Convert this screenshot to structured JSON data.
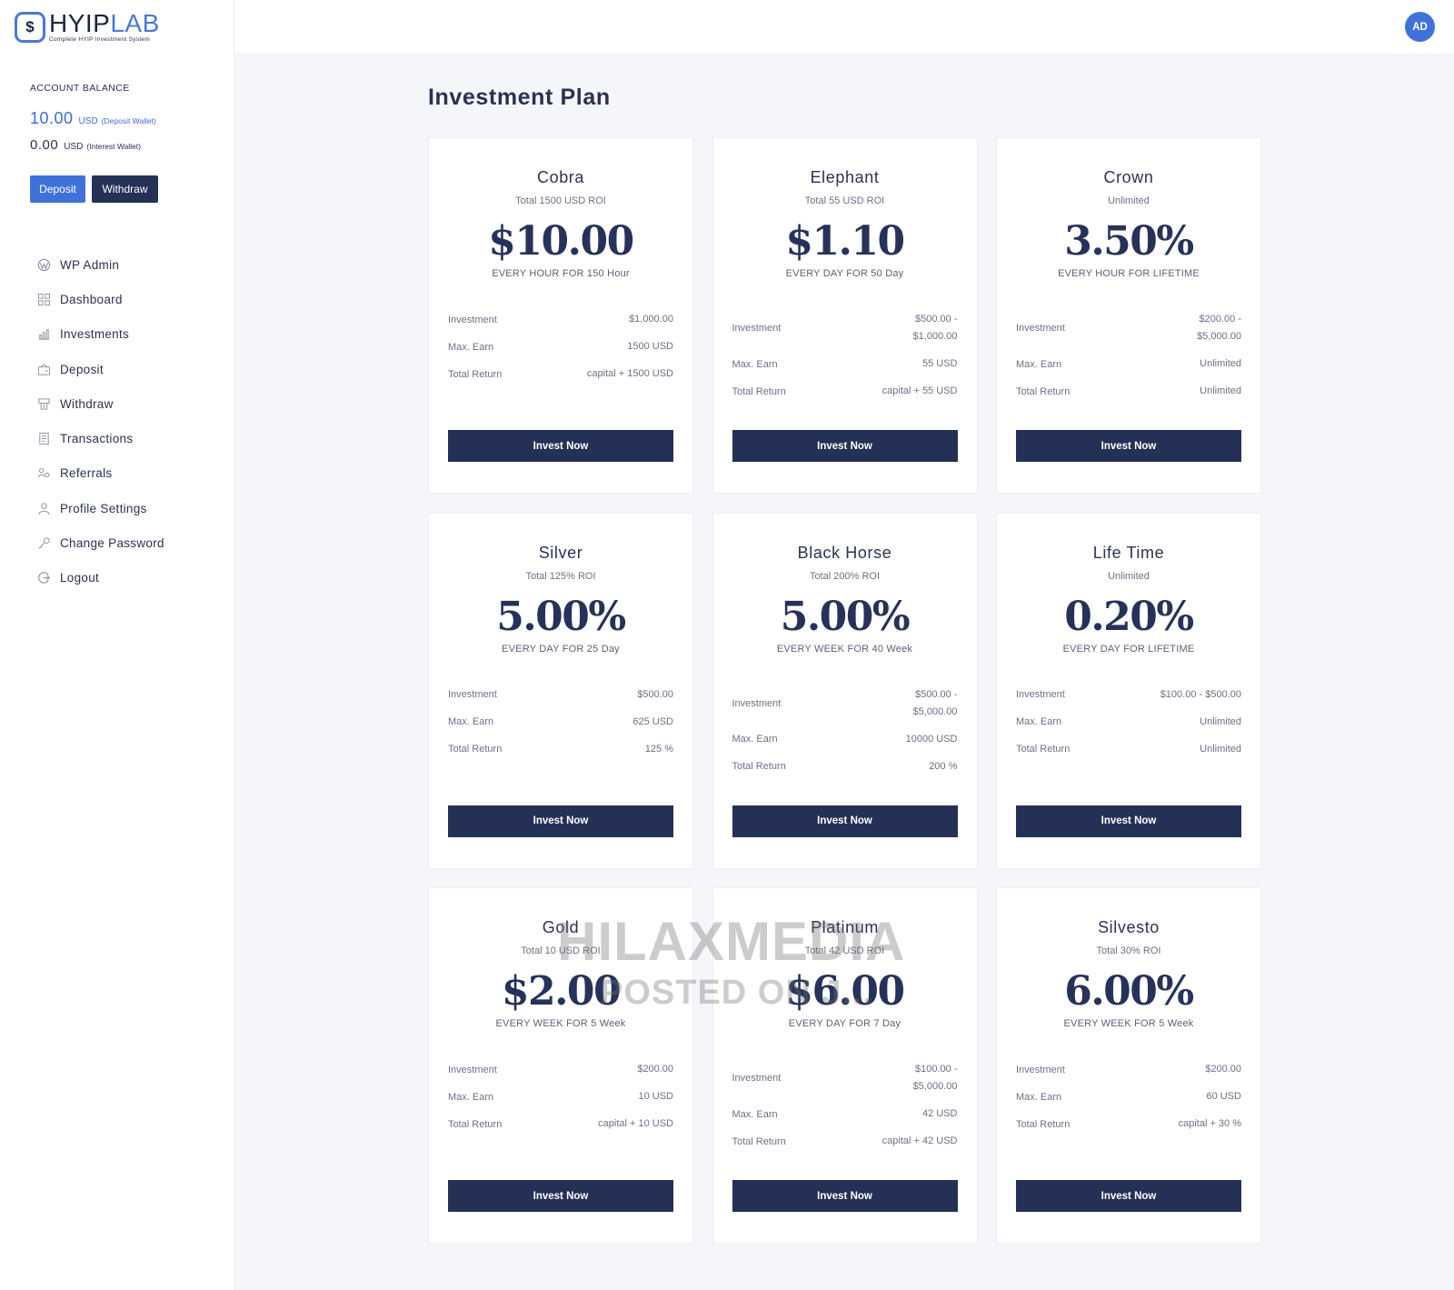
{
  "brand": {
    "name_a": "HYIP",
    "name_b": "LAB",
    "tagline": "Complete HYIP Investment System",
    "badge": "$"
  },
  "sidebar": {
    "balance_title": "ACCOUNT BALANCE",
    "deposit_wallet": {
      "amount": "10.00",
      "unit": "USD",
      "note": "(Deposit Wallet)"
    },
    "interest_wallet": {
      "amount": "0.00",
      "unit": "USD",
      "note": "(Interest Wallet)"
    },
    "deposit_label": "Deposit",
    "withdraw_label": "Withdraw",
    "nav": [
      {
        "label": "WP Admin",
        "icon": "wordpress-icon"
      },
      {
        "label": "Dashboard",
        "icon": "dashboard-grid-icon"
      },
      {
        "label": "Investments",
        "icon": "investments-chart-icon"
      },
      {
        "label": "Deposit",
        "icon": "deposit-wallet-icon"
      },
      {
        "label": "Withdraw",
        "icon": "withdraw-icon"
      },
      {
        "label": "Transactions",
        "icon": "transactions-icon"
      },
      {
        "label": "Referrals",
        "icon": "referrals-icon"
      },
      {
        "label": "Profile Settings",
        "icon": "user-icon"
      },
      {
        "label": "Change Password",
        "icon": "key-icon"
      },
      {
        "label": "Logout",
        "icon": "logout-icon"
      }
    ]
  },
  "header": {
    "avatar_initials": "AD"
  },
  "main": {
    "title": "Investment Plan",
    "invest_label": "Invest Now",
    "row_labels": {
      "investment": "Investment",
      "max_earn": "Max. Earn",
      "total_return": "Total Return"
    },
    "plans": [
      {
        "name": "Cobra",
        "sub": "Total 1500 USD ROI",
        "rate": "$10.00",
        "freq": "EVERY HOUR FOR 150 Hour",
        "investment": "$1,000.00",
        "max_earn": "1500 USD",
        "total_return": "capital + 1500 USD"
      },
      {
        "name": "Elephant",
        "sub": "Total 55 USD ROI",
        "rate": "$1.10",
        "freq": "EVERY DAY FOR 50 Day",
        "investment": "$500.00 - $1,000.00",
        "max_earn": "55 USD",
        "total_return": "capital + 55 USD"
      },
      {
        "name": "Crown",
        "sub": "Unlimited",
        "rate": "3.50%",
        "freq": "EVERY HOUR FOR LIFETIME",
        "investment": "$200.00 - $5,000.00",
        "max_earn": "Unlimited",
        "total_return": "Unlimited"
      },
      {
        "name": "Silver",
        "sub": "Total 125% ROI",
        "rate": "5.00%",
        "freq": "EVERY DAY FOR 25 Day",
        "investment": "$500.00",
        "max_earn": "625 USD",
        "total_return": "125 %"
      },
      {
        "name": "Black Horse",
        "sub": "Total 200% ROI",
        "rate": "5.00%",
        "freq": "EVERY WEEK FOR 40 Week",
        "investment": "$500.00 - $5,000.00",
        "max_earn": "10000 USD",
        "total_return": "200 %"
      },
      {
        "name": "Life Time",
        "sub": "Unlimited",
        "rate": "0.20%",
        "freq": "EVERY DAY FOR LIFETIME",
        "investment": "$100.00 - $500.00",
        "max_earn": "Unlimited",
        "total_return": "Unlimited"
      },
      {
        "name": "Gold",
        "sub": "Total 10 USD ROI",
        "rate": "$2.00",
        "freq": "EVERY WEEK FOR 5 Week",
        "investment": "$200.00",
        "max_earn": "10 USD",
        "total_return": "capital + 10 USD"
      },
      {
        "name": "Platinum",
        "sub": "Total 42 USD ROI",
        "rate": "$6.00",
        "freq": "EVERY DAY FOR 7 Day",
        "investment": "$100.00 - $5,000.00",
        "max_earn": "42 USD",
        "total_return": "capital + 42 USD"
      },
      {
        "name": "Silvesto",
        "sub": "Total 30% ROI",
        "rate": "6.00%",
        "freq": "EVERY WEEK FOR 5 Week",
        "investment": "$200.00",
        "max_earn": "60 USD",
        "total_return": "capital + 30 %"
      }
    ]
  },
  "watermark": {
    "line1": "HILAXMEDIA",
    "line2": "POSTED ON J..."
  }
}
